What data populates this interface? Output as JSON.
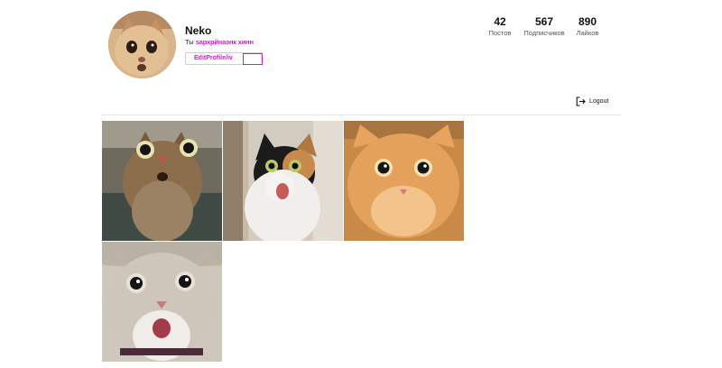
{
  "profile": {
    "username": "Neko",
    "bio_prefix": "Ты",
    "bio_glitch": "ѕархрйнаэнк хинн",
    "edit_button_label": "EditProfile/iv"
  },
  "stats": [
    {
      "value": "42",
      "label": "Постов"
    },
    {
      "value": "567",
      "label": "Подписчиков"
    },
    {
      "value": "890",
      "label": "Лайков"
    }
  ],
  "actions": {
    "logout_label": "Logout"
  },
  "posts": [
    {
      "icon": "cat-photo"
    },
    {
      "icon": "cat-photo"
    },
    {
      "icon": "cat-photo"
    },
    {
      "icon": "cat-photo"
    }
  ],
  "colors": {
    "glitch_magenta": "#d01ad0",
    "divider": "#e4e4e4"
  }
}
